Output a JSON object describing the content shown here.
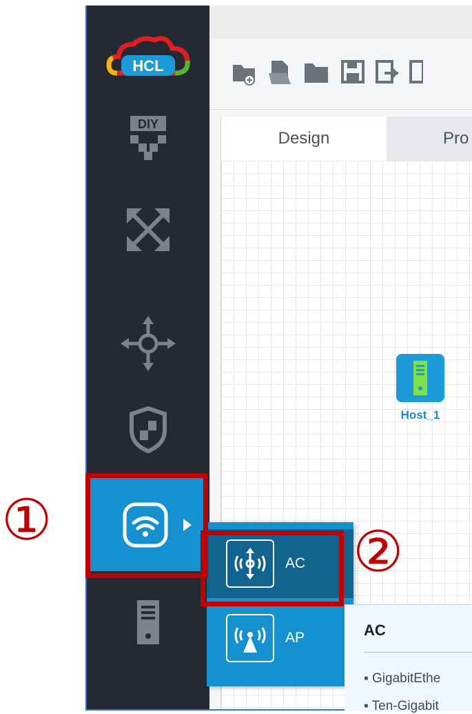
{
  "app": {
    "logo_text": "HCL"
  },
  "sidebar": {
    "items": [
      {
        "name": "diy",
        "icon": "diy-icon",
        "label": "DIY"
      },
      {
        "name": "topology",
        "icon": "topology-arrows-icon"
      },
      {
        "name": "move",
        "icon": "move-icon"
      },
      {
        "name": "security",
        "icon": "shield-icon"
      },
      {
        "name": "wireless",
        "icon": "wifi-icon",
        "selected": true
      },
      {
        "name": "server",
        "icon": "server-icon"
      }
    ]
  },
  "toolbar": {
    "icons": [
      "new-folder-icon",
      "open-file-icon",
      "open-folder-icon",
      "save-icon",
      "export-icon",
      "more-icon"
    ]
  },
  "tabs": [
    {
      "label": "Design",
      "active": true
    },
    {
      "label": "Pro"
    }
  ],
  "canvas": {
    "devices": [
      {
        "label": "Host_1",
        "icon": "host-icon"
      }
    ]
  },
  "wireless_menu": {
    "items": [
      {
        "label": "AC",
        "icon": "ac-icon",
        "hovered": true
      },
      {
        "label": "AP",
        "icon": "ap-icon"
      }
    ]
  },
  "tooltip": {
    "title": "AC",
    "lines": [
      "GigabitEthe",
      "Ten-Gigabit"
    ]
  },
  "annotations": {
    "callout_1": "①",
    "callout_2": "②"
  },
  "colors": {
    "sidebar_bg": "#242932",
    "accent_blue": "#1691cf",
    "highlight_red": "#c00000",
    "host_green": "#7be04a"
  }
}
